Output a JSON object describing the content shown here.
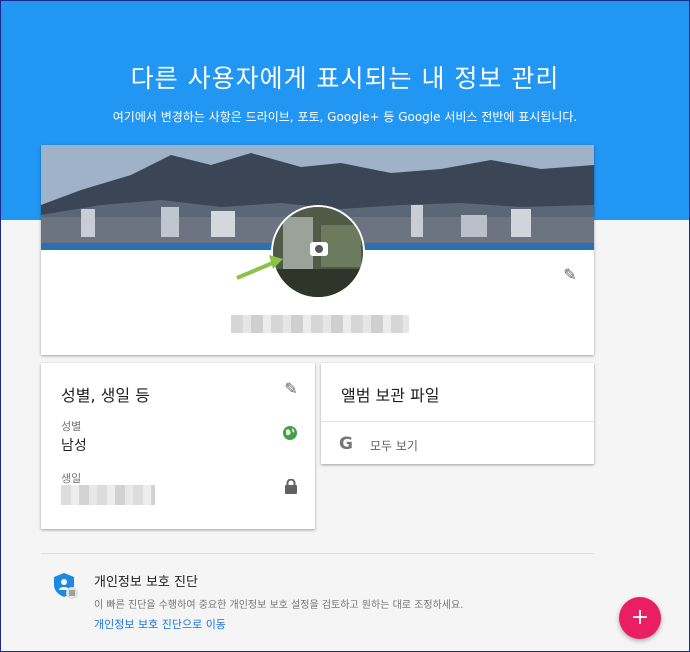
{
  "header": {
    "title": "다른 사용자에게 표시되는 내 정보 관리",
    "subtitle": "여기에서 변경하는 사항은 드라이브, 포토, Google+ 등 Google 서비스 전반에 표시됩니다."
  },
  "profile": {
    "edit_icon": "pencil-icon",
    "camera_icon": "camera-icon"
  },
  "info_card": {
    "title": "성별, 생일 등",
    "gender_label": "성별",
    "gender_value": "남성",
    "birthday_label": "생일",
    "gender_visibility_icon": "globe-icon",
    "birthday_visibility_icon": "lock-icon"
  },
  "album_card": {
    "title": "앨범 보관 파일",
    "link_label": "모두 보기"
  },
  "checkup": {
    "title": "개인정보 보호 진단",
    "description": "이 빠른 진단을 수행하여 중요한 개인정보 보호 설정을 검토하고 원하는 대로 조정하세요.",
    "link_label": "개인정보 보호 진단으로 이동"
  },
  "fab": {
    "label": "+"
  },
  "colors": {
    "hero": "#2196f3",
    "fab": "#e91e63",
    "link": "#1a73e8",
    "globe": "#43a047",
    "shield": "#1e88e5",
    "arrow": "#8bc34a"
  }
}
